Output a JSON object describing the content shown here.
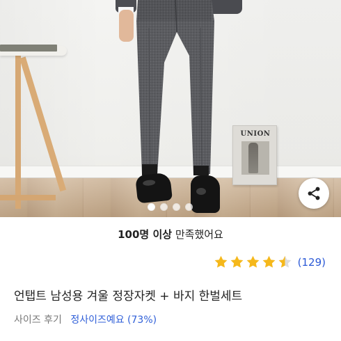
{
  "product": {
    "satisfaction": {
      "highlight": "100명 이상",
      "text": "만족했어요"
    },
    "rating": {
      "stars": 4.5,
      "review_count": "(129)"
    },
    "title": "언탭트 남성용 겨울 정장자켓 + 바지 한벌세트",
    "size_review": {
      "label": "사이즈 후기",
      "value": "정사이즈예요 (73%)"
    }
  },
  "image": {
    "magazine_text": "UNION",
    "carousel": {
      "total": 4,
      "active_index": 0
    }
  },
  "icons": {
    "share": "share-icon",
    "star": "star-icon"
  },
  "colors": {
    "star": "#f5b81b",
    "link": "#2b59d6",
    "text": "#222222",
    "muted": "#777777"
  }
}
